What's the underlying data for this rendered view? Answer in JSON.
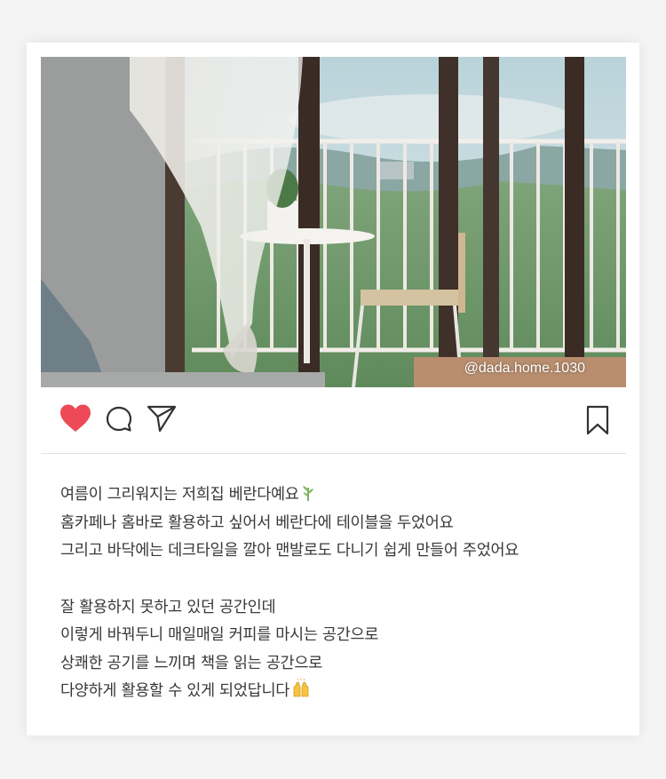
{
  "post": {
    "photo": {
      "description_icon": "photo-image",
      "watermark": "@dada.home.1030"
    },
    "actions": {
      "like_icon": "heart-icon",
      "comment_icon": "comment-icon",
      "share_icon": "send-icon",
      "save_icon": "bookmark-icon",
      "like_color": "#ed4956"
    },
    "caption": {
      "lines": [
        "여름이 그리워지는 저희집 베란다예요",
        "홈카페나 홈바로 활용하고 싶어서 베란다에 테이블을 두었어요",
        "그리고 바닥에는 데크타일을 깔아 맨발로도 다니기 쉽게 만들어 주었어요",
        "",
        "잘 활용하지 못하고 있던 공간인데",
        "이렇게 바꿔두니 매일매일 커피를 마시는 공간으로",
        "상쾌한 공기를 느끼며 책을 읽는 공간으로",
        "다양하게 활용할 수 있게 되었답니다"
      ],
      "line1_emoji": "herb-emoji",
      "last_line_emoji": "raised-hands-emoji"
    }
  }
}
